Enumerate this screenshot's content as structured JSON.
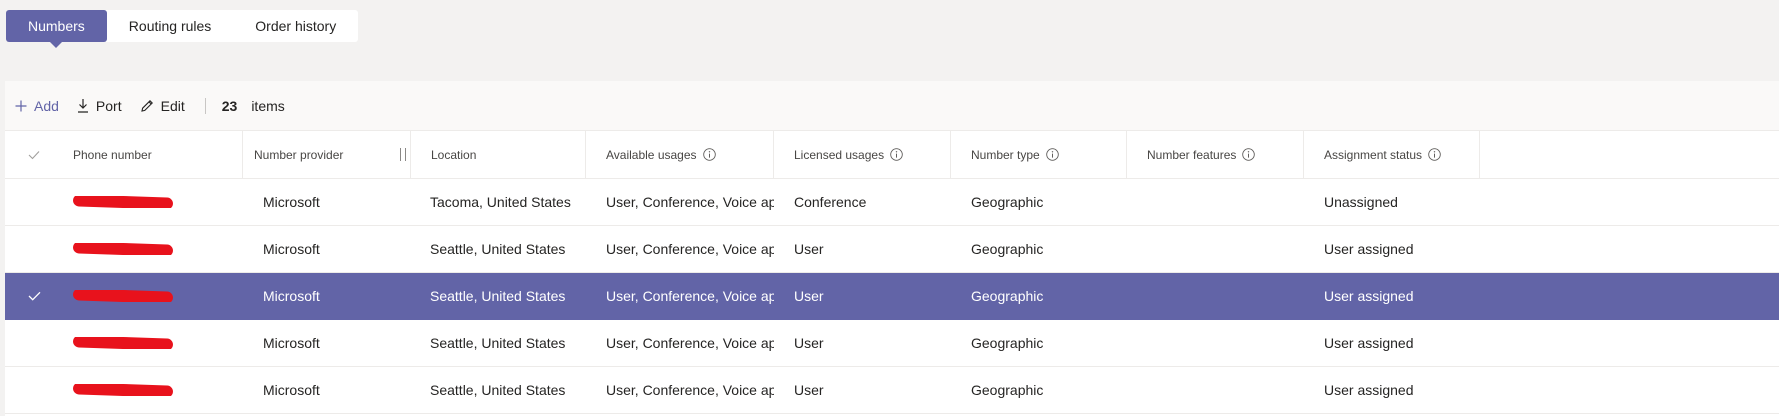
{
  "tabs": [
    {
      "label": "Numbers",
      "active": true
    },
    {
      "label": "Routing rules",
      "active": false
    },
    {
      "label": "Order history",
      "active": false
    }
  ],
  "toolbar": {
    "add_label": "Add",
    "port_label": "Port",
    "edit_label": "Edit",
    "count": "23",
    "count_suffix": "items"
  },
  "table": {
    "columns": [
      "Phone number",
      "Number provider",
      "Location",
      "Available usages",
      "Licensed usages",
      "Number type",
      "Number features",
      "Assignment status"
    ],
    "rows": [
      {
        "provider": "Microsoft",
        "location": "Tacoma, United States",
        "available": "User, Conference, Voice app",
        "licensed": "Conference",
        "type": "Geographic",
        "features": "",
        "status": "Unassigned",
        "selected": false
      },
      {
        "provider": "Microsoft",
        "location": "Seattle, United States",
        "available": "User, Conference, Voice app",
        "licensed": "User",
        "type": "Geographic",
        "features": "",
        "status": "User assigned",
        "selected": false
      },
      {
        "provider": "Microsoft",
        "location": "Seattle, United States",
        "available": "User, Conference, Voice app",
        "licensed": "User",
        "type": "Geographic",
        "features": "",
        "status": "User assigned",
        "selected": true
      },
      {
        "provider": "Microsoft",
        "location": "Seattle, United States",
        "available": "User, Conference, Voice app",
        "licensed": "User",
        "type": "Geographic",
        "features": "",
        "status": "User assigned",
        "selected": false
      },
      {
        "provider": "Microsoft",
        "location": "Seattle, United States",
        "available": "User, Conference, Voice app",
        "licensed": "User",
        "type": "Geographic",
        "features": "",
        "status": "User assigned",
        "selected": false
      }
    ]
  },
  "colors": {
    "accent": "#6264a7",
    "redaction": "#e8121c"
  },
  "icons": {
    "add": "plus-icon",
    "port": "download-icon",
    "edit": "pencil-icon",
    "info": "info-icon",
    "check": "checkmark-icon"
  }
}
